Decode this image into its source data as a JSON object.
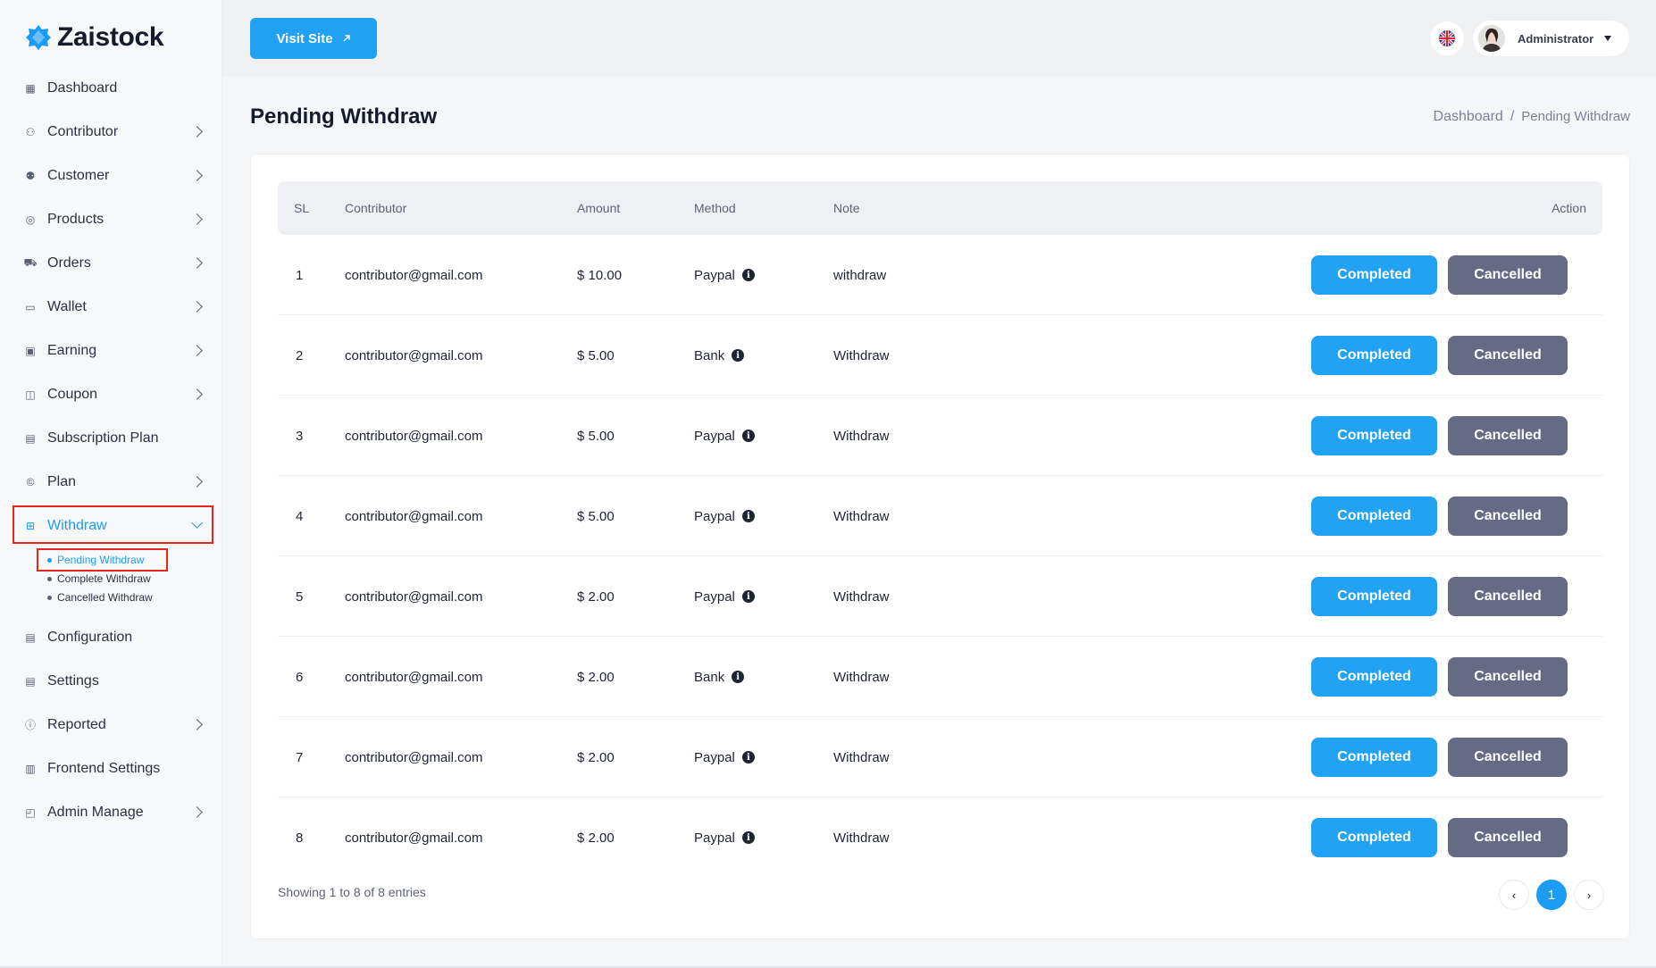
{
  "brand": {
    "name": "Zaistock",
    "accent": "#1c9cf2"
  },
  "sidebar": {
    "items": [
      {
        "label": "Dashboard",
        "icon": "dashboard-icon",
        "has_children": false
      },
      {
        "label": "Contributor",
        "icon": "contributor-icon",
        "has_children": true
      },
      {
        "label": "Customer",
        "icon": "customer-icon",
        "has_children": true
      },
      {
        "label": "Products",
        "icon": "products-icon",
        "has_children": true
      },
      {
        "label": "Orders",
        "icon": "cart-icon",
        "has_children": true
      },
      {
        "label": "Wallet",
        "icon": "wallet-icon",
        "has_children": true
      },
      {
        "label": "Earning",
        "icon": "earning-icon",
        "has_children": true
      },
      {
        "label": "Coupon",
        "icon": "coupon-icon",
        "has_children": true
      },
      {
        "label": "Subscription Plan",
        "icon": "subscription-icon",
        "has_children": false
      },
      {
        "label": "Plan",
        "icon": "plan-icon",
        "has_children": true
      },
      {
        "label": "Withdraw",
        "icon": "withdraw-icon",
        "has_children": true,
        "active": true
      },
      {
        "label": "Configuration",
        "icon": "configuration-icon",
        "has_children": false
      },
      {
        "label": "Settings",
        "icon": "settings-icon",
        "has_children": false
      },
      {
        "label": "Reported",
        "icon": "reported-icon",
        "has_children": true
      },
      {
        "label": "Frontend Settings",
        "icon": "frontend-icon",
        "has_children": false
      },
      {
        "label": "Admin Manage",
        "icon": "admin-icon",
        "has_children": true
      }
    ],
    "withdraw_sub": [
      "Pending Withdraw",
      "Complete Withdraw",
      "Cancelled Withdraw"
    ]
  },
  "header": {
    "visit_label": "Visit Site",
    "user_name": "Administrator",
    "language_icon": "uk-flag-icon"
  },
  "page": {
    "title": "Pending Withdraw",
    "breadcrumb": [
      "Dashboard",
      "/",
      "Pending Withdraw"
    ]
  },
  "table": {
    "columns": [
      "SL",
      "Contributor",
      "Amount",
      "Method",
      "Note",
      "Action"
    ],
    "rows": [
      {
        "sl": "1",
        "contributor": "contributor@gmail.com",
        "amount": "$ 10.00",
        "method": "Paypal",
        "note": "withdraw"
      },
      {
        "sl": "2",
        "contributor": "contributor@gmail.com",
        "amount": "$ 5.00",
        "method": "Bank",
        "note": "Withdraw"
      },
      {
        "sl": "3",
        "contributor": "contributor@gmail.com",
        "amount": "$ 5.00",
        "method": "Paypal",
        "note": "Withdraw"
      },
      {
        "sl": "4",
        "contributor": "contributor@gmail.com",
        "amount": "$ 5.00",
        "method": "Paypal",
        "note": "Withdraw"
      },
      {
        "sl": "5",
        "contributor": "contributor@gmail.com",
        "amount": "$ 2.00",
        "method": "Paypal",
        "note": "Withdraw"
      },
      {
        "sl": "6",
        "contributor": "contributor@gmail.com",
        "amount": "$ 2.00",
        "method": "Bank",
        "note": "Withdraw"
      },
      {
        "sl": "7",
        "contributor": "contributor@gmail.com",
        "amount": "$ 2.00",
        "method": "Paypal",
        "note": "Withdraw"
      },
      {
        "sl": "8",
        "contributor": "contributor@gmail.com",
        "amount": "$ 2.00",
        "method": "Paypal",
        "note": "Withdraw"
      }
    ],
    "complete_label": "Completed",
    "cancel_label": "Cancelled",
    "info_glyph": "i"
  },
  "footer": {
    "showing": "Showing 1 to 8 of 8 entries",
    "prev": "‹",
    "page": "1",
    "next": "›"
  },
  "colors": {
    "complete": "#22a2f2",
    "cancel": "#676a84",
    "highlight": "#e5261f"
  }
}
